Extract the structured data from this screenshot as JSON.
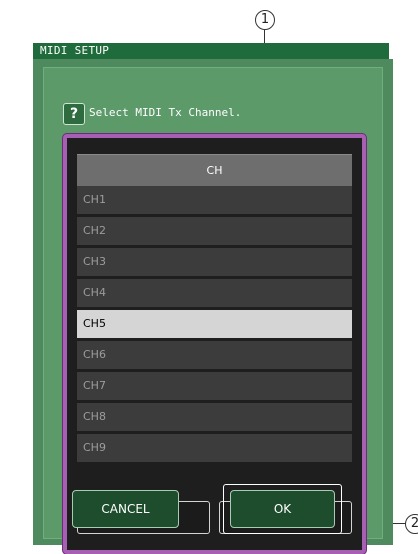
{
  "callouts": [
    "1",
    "2"
  ],
  "dialog": {
    "title": "MIDI SETUP",
    "help_icon": "?",
    "prompt": "Select MIDI Tx Channel."
  },
  "list": {
    "header": "CH",
    "items": [
      "CH1",
      "CH2",
      "CH3",
      "CH4",
      "CH5",
      "CH6",
      "CH7",
      "CH8",
      "CH9"
    ],
    "selected": "CH5"
  },
  "scroll": {
    "up_icon": "arrow-up-icon",
    "down_icon": "arrow-down-icon",
    "up_glyph": "↑",
    "down_glyph": "↓"
  },
  "buttons": {
    "cancel": "CANCEL",
    "ok": "OK"
  },
  "colors": {
    "dialog_bg": "#4f8a5e",
    "titlebar": "#1f6b3c",
    "list_frame": "#a65fb3",
    "selected_row": "#d5d5d5"
  }
}
